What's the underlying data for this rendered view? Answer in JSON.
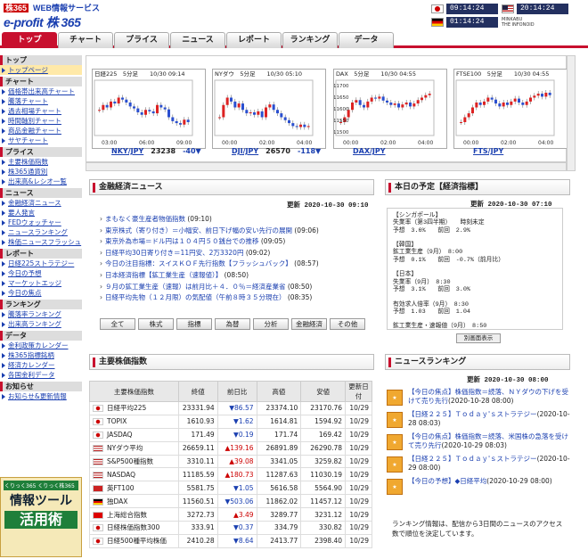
{
  "header": {
    "logo_badge": "株365",
    "logo_service": "WEB情報サービス",
    "logo_main": "e-profit 株 365",
    "minkabu": "MINKABU\nTHE INFONOID",
    "clocks": [
      {
        "time": "09:14:24"
      },
      {
        "time": "20:14:24"
      },
      {
        "time": "01:14:24"
      }
    ]
  },
  "nav": {
    "tabs": [
      "トップ",
      "チャート",
      "プライス",
      "ニュース",
      "レポート",
      "ランキング",
      "データ"
    ]
  },
  "sidebar": [
    {
      "head": "トップ",
      "items": [
        "トップページ"
      ]
    },
    {
      "head": "チャート",
      "items": [
        "価格帯出来高チャート",
        "騰落チャート",
        "過去相場チャート",
        "時間軸別チャート",
        "商品金融チャート",
        "サヤチャート"
      ]
    },
    {
      "head": "プライス",
      "items": [
        "主要株価指数",
        "株365通貨別",
        "出来高&レシオ一覧"
      ]
    },
    {
      "head": "ニュース",
      "items": [
        "金融経済ニュース",
        "要人発言",
        "FEDウォッチャー",
        "ニュースランキング",
        "株価ニュースフラッシュ"
      ]
    },
    {
      "head": "レポート",
      "items": [
        "日経225ストラテジー",
        "今日の予想",
        "マーケットエッジ",
        "今日の焦点"
      ]
    },
    {
      "head": "ランキング",
      "items": [
        "騰落率ランキング",
        "出来高ランキング"
      ]
    },
    {
      "head": "データ",
      "items": [
        "金利政策カレンダー",
        "株365指標銘柄",
        "経済カレンダー",
        "各国金利データ"
      ]
    },
    {
      "head": "お知らせ",
      "items": [
        "お知らせ&更新情報"
      ]
    }
  ],
  "ad": {
    "badge": "くりっく365 くりっく株365",
    "line1": "情報ツール",
    "line2": "活用術"
  },
  "charts": [
    {
      "label": "日経225",
      "tf": "5分足",
      "time": "10/30 09:14",
      "name": "NKY/JPY",
      "price": "23238",
      "change": "-40▼",
      "ticks": [
        "03:00",
        "06:00",
        "09:00"
      ]
    },
    {
      "label": "NYダウ",
      "tf": "5分足",
      "time": "10/30 05:10",
      "name": "DJI/JPY",
      "price": "26570",
      "change": "-118▼",
      "ticks": [
        "00:00",
        "02:00",
        "04:00"
      ]
    },
    {
      "label": "DAX",
      "tf": "5分足",
      "time": "10/30 04:55",
      "name": "DAX/JPY",
      "price": "",
      "change": "",
      "ticks": [
        "00:00",
        "02:00",
        "04:00"
      ],
      "yticks": [
        "11700",
        "11650",
        "11600",
        "11550",
        "11500"
      ]
    },
    {
      "label": "FTSE100",
      "tf": "5分足",
      "time": "10/30 04:55",
      "name": "FTS/JPY",
      "price": "",
      "change": "",
      "ticks": [
        "00:00",
        "02:00",
        "04:00"
      ]
    }
  ],
  "news": {
    "title": "金融経済ニュース",
    "updated": "更新 2020-10-30 09:10",
    "items": [
      {
        "text": "まもなく豪生産者物価指数",
        "time": " (09:10)"
      },
      {
        "text": "東京株式（寄り付き）＝小幅安、前日下げ幅の安い先行の展開",
        "time": " (09:06)"
      },
      {
        "text": "東京外為市場＝ドル円は１０４円５０銭台での推移",
        "time": " (09:05)"
      },
      {
        "text": "日経平均30日寄り付き＝11円安、2万3320円",
        "time": " (09:02)"
      },
      {
        "text": "今日の注目指標：スイスＫＯＦ先行指数【フラッシュバック】",
        "time": " (08:57)"
      },
      {
        "text": "日本経済指標【鉱工業生産（速報値）】",
        "time": " (08:50)"
      },
      {
        "text": "９月の鉱工業生産（速報）は前月比＋４．０％＝経済産業省",
        "time": " (08:50)"
      },
      {
        "text": "日経平均先物（１２月限）の気配値（午前８時３５分現在）",
        "time": " (08:35)"
      }
    ],
    "buttons": [
      "全て",
      "株式",
      "指標",
      "為替",
      "分析",
      "金融経済",
      "その他"
    ]
  },
  "indices": {
    "title": "主要株価指数",
    "cols": [
      "主要株価指数",
      "終値",
      "前日比",
      "高値",
      "安値",
      "更新日付"
    ],
    "rows": [
      {
        "name": "日経平均225",
        "close": "23331.94",
        "change": "▼86.57",
        "dir": "dn",
        "high": "23374.10",
        "low": "23170.76",
        "date": "10/29",
        "flag": "jp"
      },
      {
        "name": "TOPIX",
        "close": "1610.93",
        "change": "▼1.62",
        "dir": "dn",
        "high": "1614.81",
        "low": "1594.92",
        "date": "10/29",
        "flag": "jp"
      },
      {
        "name": "JASDAQ",
        "close": "171.49",
        "change": "▼0.19",
        "dir": "dn",
        "high": "171.74",
        "low": "169.42",
        "date": "10/29",
        "flag": "jp"
      },
      {
        "name": "NYダウ平均",
        "close": "26659.11",
        "change": "▲139.16",
        "dir": "up",
        "high": "26891.89",
        "low": "26290.78",
        "date": "10/29",
        "flag": "us"
      },
      {
        "name": "S&P500種指数",
        "close": "3310.11",
        "change": "▲39.08",
        "dir": "up",
        "high": "3341.05",
        "low": "3259.82",
        "date": "10/29",
        "flag": "us"
      },
      {
        "name": "NASDAQ",
        "close": "11185.59",
        "change": "▲180.73",
        "dir": "up",
        "high": "11287.63",
        "low": "11030.19",
        "date": "10/29",
        "flag": "us"
      },
      {
        "name": "英FT100",
        "close": "5581.75",
        "change": "▼1.05",
        "dir": "dn",
        "high": "5616.58",
        "low": "5564.90",
        "date": "10/29",
        "flag": "uk"
      },
      {
        "name": "独DAX",
        "close": "11560.51",
        "change": "▼503.06",
        "dir": "dn",
        "high": "11862.02",
        "low": "11457.12",
        "date": "10/29",
        "flag": "de"
      },
      {
        "name": "上海総合指数",
        "close": "3272.73",
        "change": "▲3.49",
        "dir": "up",
        "high": "3289.77",
        "low": "3231.12",
        "date": "10/29",
        "flag": "cn"
      },
      {
        "name": "日経株価指数300",
        "close": "333.91",
        "change": "▼0.37",
        "dir": "dn",
        "high": "334.79",
        "low": "330.82",
        "date": "10/29",
        "flag": "jp"
      },
      {
        "name": "日経500種平均株価",
        "close": "2410.28",
        "change": "▼8.64",
        "dir": "dn",
        "high": "2413.77",
        "low": "2398.40",
        "date": "10/29",
        "flag": "jp"
      }
    ]
  },
  "schedule": {
    "title": "本日の予定【経済指標】",
    "updated": "更新 2020-10-30 07:10",
    "button": "別画面表示",
    "text": "【シンガポール】\n失業率（第3四半期）　　時刻未定\n予想　3.6%　　前回　2.9%\n\n【韓国】\n鉱工業生産（9月）　8:00\n予想　0.1%　　前回　-0.7%（前月比）\n\n【日本】\n失業率（9月）　8:30\n予想　3.1%　　前回　3.0%\n\n有効求人倍率（9月）　8:30\n予想　1.03　　前回　1.04\n\n鉱工業生産・速報値（9月）　8:50\n予想　3.0%　　前回　1.0%（前月比）"
  },
  "ranking": {
    "title": "ニュースランキング",
    "updated": "更新 2020-10-30 08:00",
    "items": [
      {
        "text": "【今日の焦点】株価指数＝続落、ＮＹダウの下げを受けて売り先行",
        "time": "(2020-10-28 08:00)"
      },
      {
        "text": "【日経２２５】Ｔｏｄａｙ'ｓストラテジー",
        "time": "(2020-10-28 08:03)"
      },
      {
        "text": "【今日の焦点】株価指数＝続落、米国株の急落を受けて売り先行",
        "time": "(2020-10-29 08:03)"
      },
      {
        "text": "【日経２２５】Ｔｏｄａｙ'ｓストラテジー",
        "time": "(2020-10-29 08:00)"
      },
      {
        "text": "【今日の予想】◆日経平均",
        "time": "(2020-10-29 08:00)"
      }
    ],
    "note": "ランキング情報は、配信から3日間のニュースのアクセス数で順位を決定しています。"
  }
}
